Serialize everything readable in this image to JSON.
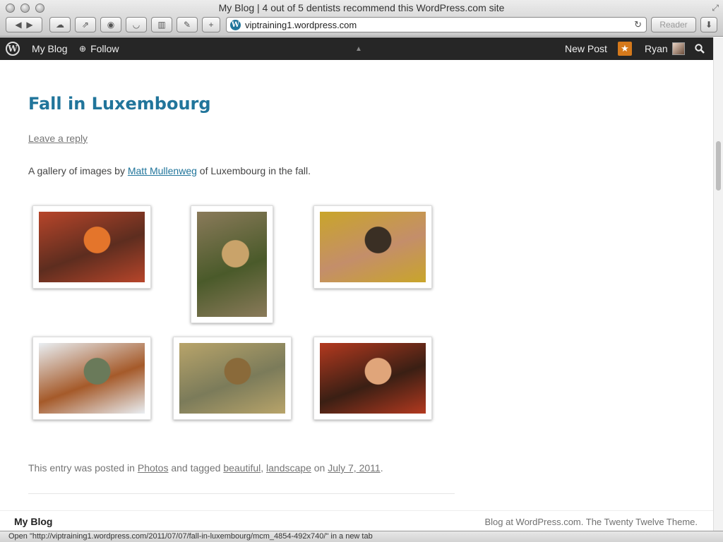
{
  "window": {
    "title": "My Blog | 4 out of 5 dentists recommend this WordPress.com site"
  },
  "browser": {
    "url": "viptraining1.wordpress.com",
    "reader_label": "Reader",
    "add_label": "+"
  },
  "adminbar": {
    "site_name": "My Blog",
    "follow_label": "Follow",
    "new_post_label": "New Post",
    "user_name": "Ryan"
  },
  "post": {
    "title": "Fall in Luxembourg",
    "reply_label": "Leave a reply",
    "intro_before": "A gallery of images by ",
    "intro_author": "Matt Mullenweg",
    "intro_after": " of Luxembourg in the fall.",
    "gallery": [
      {
        "name": "pumpkin-leaves",
        "colors": [
          "#b7452a",
          "#e4752b",
          "#5d2d1f"
        ]
      },
      {
        "name": "stone-steps",
        "colors": [
          "#8a7a5a",
          "#c9a36a",
          "#4a5a2a"
        ]
      },
      {
        "name": "autumn-forest-path",
        "colors": [
          "#c9a52a",
          "#3a2f24",
          "#c48e6a"
        ]
      },
      {
        "name": "park-fountain",
        "colors": [
          "#e9eef2",
          "#6a7a5a",
          "#a55a2a"
        ]
      },
      {
        "name": "fallen-leaves-ground",
        "colors": [
          "#b8a46a",
          "#8a6a3a",
          "#7b7b5a"
        ]
      },
      {
        "name": "red-autumn-tree",
        "colors": [
          "#b3391f",
          "#e0a57a",
          "#3a1f14"
        ]
      }
    ],
    "meta_prefix": "This entry was posted in ",
    "category": "Photos",
    "meta_tagged": " and tagged ",
    "tag1": "beautiful",
    "comma": ", ",
    "tag2": "landscape",
    "meta_on": " on ",
    "date": "July 7, 2011",
    "period": "."
  },
  "footer": {
    "site_title": "My Blog",
    "credit": "Blog at WordPress.com. The Twenty Twelve Theme."
  },
  "statusbar": {
    "text": "Open \"http://viptraining1.wordpress.com/2011/07/07/fall-in-luxembourg/mcm_4854-492x740/\" in a new tab"
  },
  "colors": {
    "link": "#21759b",
    "adminbar": "#262626",
    "notification": "#d5791b"
  }
}
